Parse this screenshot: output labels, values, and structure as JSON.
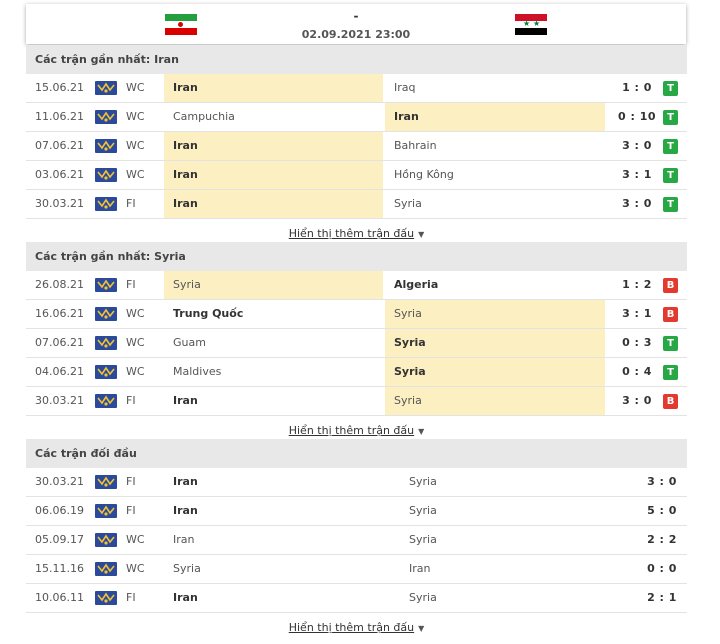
{
  "match": {
    "score": "-",
    "datetime": "02.09.2021 23:00",
    "home_flag": "iran-flag",
    "away_flag": "syria-flag"
  },
  "more_label": "Hiển thị thêm trận đấu",
  "colors": {
    "win": "#27a844",
    "loss": "#e23a2f",
    "highlight": "#fcf0c2"
  },
  "iran_recent": {
    "title": "Các trận gần nhất: Iran",
    "rows": [
      {
        "date": "15.06.21",
        "league": "WC",
        "home": "Iran",
        "away": "Iraq",
        "score": "1 : 0",
        "result": "T"
      },
      {
        "date": "11.06.21",
        "league": "WC",
        "home": "Campuchia",
        "away": "Iran",
        "score": "0 : 10",
        "result": "T"
      },
      {
        "date": "07.06.21",
        "league": "WC",
        "home": "Iran",
        "away": "Bahrain",
        "score": "3 : 0",
        "result": "T"
      },
      {
        "date": "03.06.21",
        "league": "WC",
        "home": "Iran",
        "away": "Hồng Kông",
        "score": "3 : 1",
        "result": "T"
      },
      {
        "date": "30.03.21",
        "league": "FI",
        "home": "Iran",
        "away": "Syria",
        "score": "3 : 0",
        "result": "T"
      }
    ]
  },
  "syria_recent": {
    "title": "Các trận gần nhất: Syria",
    "rows": [
      {
        "date": "26.08.21",
        "league": "FI",
        "home": "Syria",
        "away": "Algeria",
        "score": "1 : 2",
        "result": "B"
      },
      {
        "date": "16.06.21",
        "league": "WC",
        "home": "Trung Quốc",
        "away": "Syria",
        "score": "3 : 1",
        "result": "B"
      },
      {
        "date": "07.06.21",
        "league": "WC",
        "home": "Guam",
        "away": "Syria",
        "score": "0 : 3",
        "result": "T"
      },
      {
        "date": "04.06.21",
        "league": "WC",
        "home": "Maldives",
        "away": "Syria",
        "score": "0 : 4",
        "result": "T"
      },
      {
        "date": "30.03.21",
        "league": "FI",
        "home": "Iran",
        "away": "Syria",
        "score": "3 : 0",
        "result": "B"
      }
    ]
  },
  "h2h": {
    "title": "Các trận đối đầu",
    "rows": [
      {
        "date": "30.03.21",
        "league": "FI",
        "home": "Iran",
        "away": "Syria",
        "score": "3 : 0"
      },
      {
        "date": "06.06.19",
        "league": "FI",
        "home": "Iran",
        "away": "Syria",
        "score": "5 : 0"
      },
      {
        "date": "05.09.17",
        "league": "WC",
        "home": "Iran",
        "away": "Syria",
        "score": "2 : 2"
      },
      {
        "date": "15.11.16",
        "league": "WC",
        "home": "Syria",
        "away": "Iran",
        "score": "0 : 0"
      },
      {
        "date": "10.06.11",
        "league": "FI",
        "home": "Iran",
        "away": "Syria",
        "score": "2 : 1"
      }
    ]
  }
}
